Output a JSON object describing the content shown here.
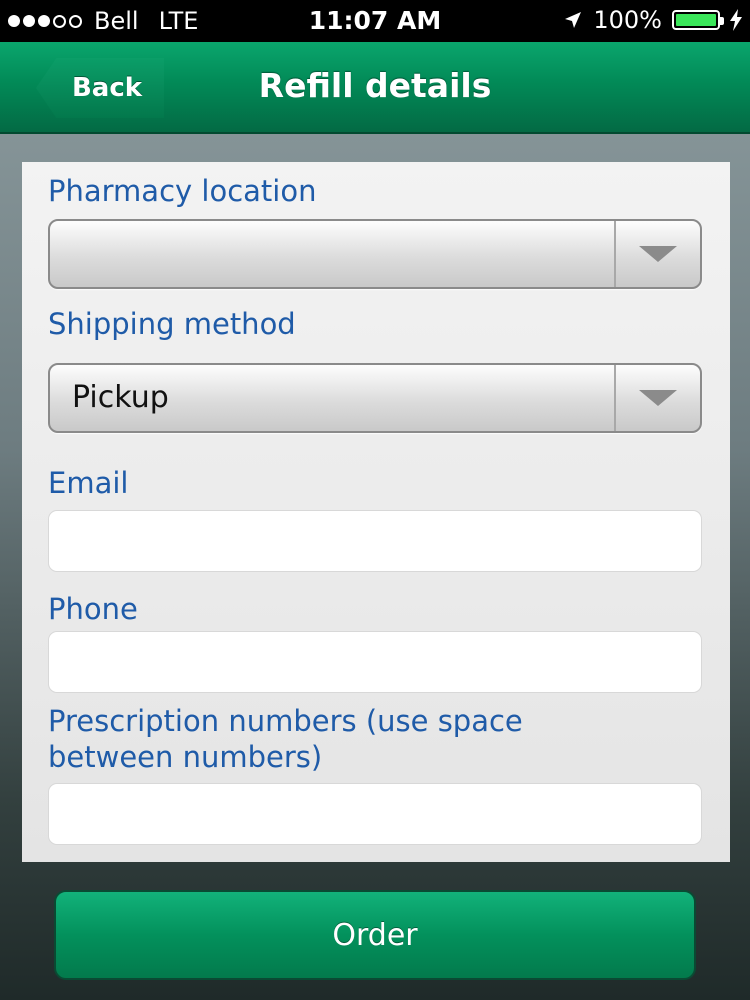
{
  "status_bar": {
    "signal_dots": [
      true,
      true,
      true,
      false,
      false
    ],
    "carrier": "Bell",
    "network": "LTE",
    "time": "11:07 AM",
    "battery_percent": "100%",
    "battery_level": 1.0
  },
  "nav": {
    "back_label": "Back",
    "title": "Refill details"
  },
  "form": {
    "pharmacy_location_label": "Pharmacy location",
    "pharmacy_location_value": "",
    "shipping_method_label": "Shipping method",
    "shipping_method_value": "Pickup",
    "email_label": "Email",
    "email_value": "",
    "phone_label": "Phone",
    "phone_value": "",
    "prescription_label_line1": "Prescription numbers (use space",
    "prescription_label_line2": "between numbers)",
    "prescription_value": ""
  },
  "order_label": "Order",
  "colors": {
    "accent_green": "#028a57",
    "label_blue": "#1f5ba8"
  }
}
